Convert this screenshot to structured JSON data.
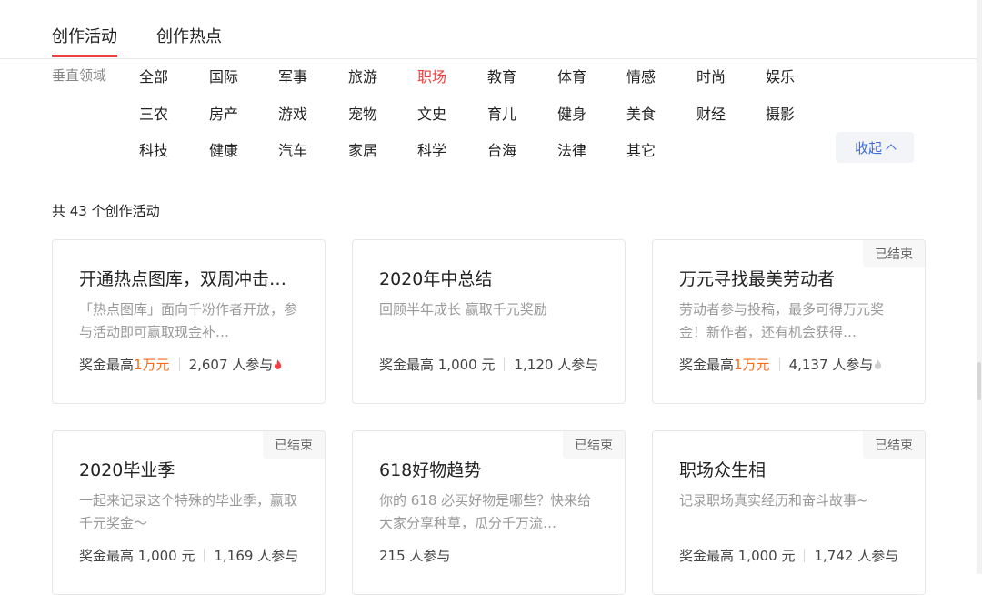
{
  "tabs": [
    "创作活动",
    "创作热点"
  ],
  "filter": {
    "label": "垂直领域",
    "rows": [
      [
        "全部",
        "国际",
        "军事",
        "旅游",
        "职场",
        "教育",
        "体育",
        "情感",
        "时尚",
        "娱乐"
      ],
      [
        "三农",
        "房产",
        "游戏",
        "宠物",
        "文史",
        "育儿",
        "健身",
        "美食",
        "财经",
        "摄影"
      ],
      [
        "科技",
        "健康",
        "汽车",
        "家居",
        "科学",
        "台海",
        "法律",
        "其它"
      ]
    ],
    "active": "职场",
    "collapse_label": "收起"
  },
  "count_text": "共 43 个创作活动",
  "cards": [
    {
      "title": "开通热点图库，双周冲击…",
      "desc": "「热点图库」面向千粉作者开放，参与活动即可赢取现金补…",
      "prize_prefix": "奖金最高",
      "prize_value": "1万元",
      "participants": "2,607 人参与",
      "badge": "",
      "flame": "red"
    },
    {
      "title": "2020年中总结",
      "desc": "回顾半年成长 赢取千元奖励",
      "prize_prefix": "奖金最高 1,000 元",
      "prize_value": "",
      "participants": "1,120 人参与",
      "badge": "",
      "flame": ""
    },
    {
      "title": "万元寻找最美劳动者",
      "desc": "劳动者参与投稿，最多可得万元奖金！新作者，还有机会获得…",
      "prize_prefix": "奖金最高",
      "prize_value": "1万元",
      "participants": "4,137 人参与",
      "badge": "已结束",
      "flame": "gray"
    },
    {
      "title": "2020毕业季",
      "desc": "一起来记录这个特殊的毕业季，赢取千元奖金～",
      "prize_prefix": "奖金最高 1,000 元",
      "prize_value": "",
      "participants": "1,169 人参与",
      "badge": "已结束",
      "flame": ""
    },
    {
      "title": "618好物趋势",
      "desc": "你的 618 必买好物是哪些？快来给大家分享种草，瓜分千万流…",
      "prize_prefix": "",
      "prize_value": "",
      "participants": "215 人参与",
      "badge": "已结束",
      "flame": ""
    },
    {
      "title": "职场众生相",
      "desc": "记录职场真实经历和奋斗故事~",
      "prize_prefix": "奖金最高 1,000 元",
      "prize_value": "",
      "participants": "1,742 人参与",
      "badge": "已结束",
      "flame": ""
    }
  ],
  "colors": {
    "accent": "#f04142",
    "link": "#3c6bd8",
    "prize": "#f86b1d"
  }
}
